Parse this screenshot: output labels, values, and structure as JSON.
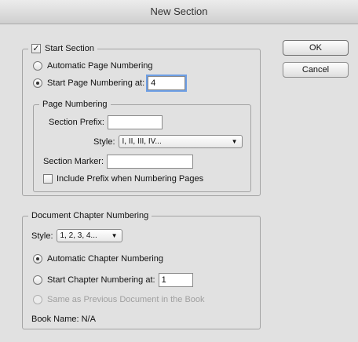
{
  "window": {
    "title": "New Section"
  },
  "buttons": {
    "ok": "OK",
    "cancel": "Cancel"
  },
  "start_section": {
    "label": "Start Section",
    "checked": true,
    "auto_numbering": "Automatic Page Numbering",
    "start_at_label": "Start Page Numbering at:",
    "start_at_value": "4"
  },
  "page_numbering": {
    "legend": "Page Numbering",
    "prefix_label": "Section Prefix:",
    "prefix_value": "",
    "style_label": "Style:",
    "style_value": "I, II, III, IV...",
    "marker_label": "Section Marker:",
    "marker_value": "",
    "include_prefix_label": "Include Prefix when Numbering Pages"
  },
  "chapter": {
    "legend": "Document Chapter Numbering",
    "style_label": "Style:",
    "style_value": "1, 2, 3, 4...",
    "auto_label": "Automatic Chapter Numbering",
    "start_label": "Start Chapter Numbering at:",
    "start_value": "1",
    "same_label": "Same as Previous Document in the Book",
    "book_name": "Book Name: N/A"
  }
}
